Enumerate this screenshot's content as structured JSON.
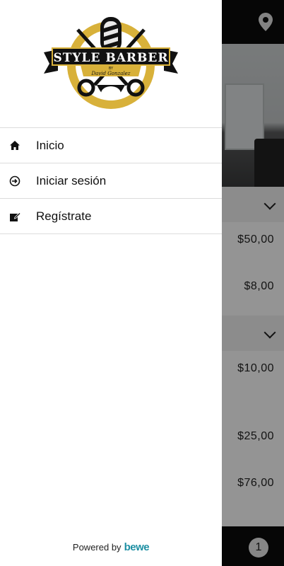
{
  "background": {
    "prices": [
      "$50,00",
      "$8,00",
      "$10,00",
      "$25,00",
      "$76,00"
    ],
    "cart_count": "1",
    "icons": {
      "location": "location-pin-icon",
      "chevron": "chevron-down-icon"
    }
  },
  "drawer": {
    "logo": {
      "title": "STYLE BARBER",
      "by": "BY",
      "signature": "David Gonzalez"
    },
    "menu": [
      {
        "label": "Inicio",
        "icon": "home-icon"
      },
      {
        "label": "Iniciar sesión",
        "icon": "login-icon"
      },
      {
        "label": "Regístrate",
        "icon": "edit-icon"
      }
    ],
    "footer": {
      "powered_by": "Powered by",
      "brand": "bewe"
    }
  },
  "colors": {
    "gold": "#d8b13a",
    "brand": "#1d8fa3",
    "dark": "#0b0b0b"
  }
}
